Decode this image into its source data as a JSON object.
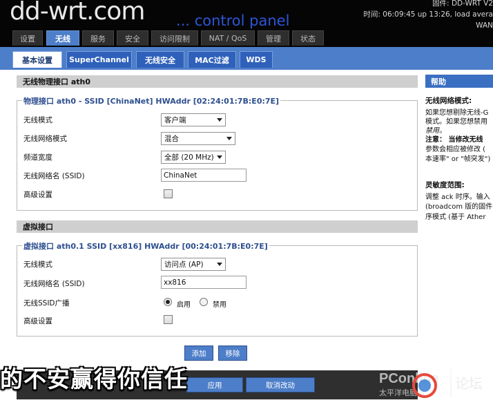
{
  "header": {
    "logo": "dd-wrt.com",
    "subtitle": "... control panel",
    "info_line1": "固件: DD-WRT V2",
    "info_line2": "时间: 06:09:45 up 13:26, load avera",
    "info_line3": "WAN"
  },
  "main_tabs": [
    "设置",
    "无线",
    "服务",
    "安全",
    "访问限制",
    "NAT / QoS",
    "管理",
    "状态"
  ],
  "sub_tabs": [
    "基本设置",
    "SuperChannel",
    "无线安全",
    "MAC过滤",
    "WDS"
  ],
  "physical_section": {
    "title": "无线物理接口  ath0",
    "legend": "物理接口  ath0 - SSID [ChinaNet] HWAddr [02:24:01:7B:E0:7E]",
    "fields": {
      "mode_label": "无线模式",
      "mode_value": "客户端",
      "net_mode_label": "无线网络模式",
      "net_mode_value": "混合",
      "channel_width_label": "频道宽度",
      "channel_width_value": "全部 (20 MHz)",
      "ssid_label": "无线网络名 (SSID)",
      "ssid_value": "ChinaNet",
      "advanced_label": "高级设置"
    }
  },
  "virtual_section": {
    "title": "虚拟接口",
    "legend": "虚拟接口  ath0.1 SSID [xx816] HWAddr [00:24:01:7B:E0:7E]",
    "fields": {
      "mode_label": "无线模式",
      "mode_value": "访问点 (AP)",
      "ssid_label": "无线网络名 (SSID)",
      "ssid_value": "xx816",
      "broadcast_label": "无线SSID广播",
      "enable_label": "启用",
      "disable_label": "禁用",
      "advanced_label": "高级设置"
    }
  },
  "buttons": {
    "add": "添加",
    "remove": "移除",
    "apply": "应用",
    "cancel": "取消改动"
  },
  "help": {
    "heading": "帮助",
    "title1": "无线网络模式:",
    "text1_l1": "如果您想剔除无线-G",
    "text1_l2": "模式。如果您想禁用",
    "text1_l3": "禁用。",
    "text1_l4": "注意：  当修改无线",
    "text1_l5": "参数会相应被修改 (",
    "text1_l6": "本速率\" or \"帧突发\")",
    "title2": "灵敏度范围:",
    "text2_l1": "调整 ack 时序。输入",
    "text2_l2": "(broadcom 版的固件",
    "text2_l3": "序模式 (基于  Ather"
  },
  "subtitle_caption": "的不安赢得你信任",
  "watermark": {
    "text1": "PConline",
    "text2": "太平洋电脑网",
    "text3": "论坛"
  }
}
